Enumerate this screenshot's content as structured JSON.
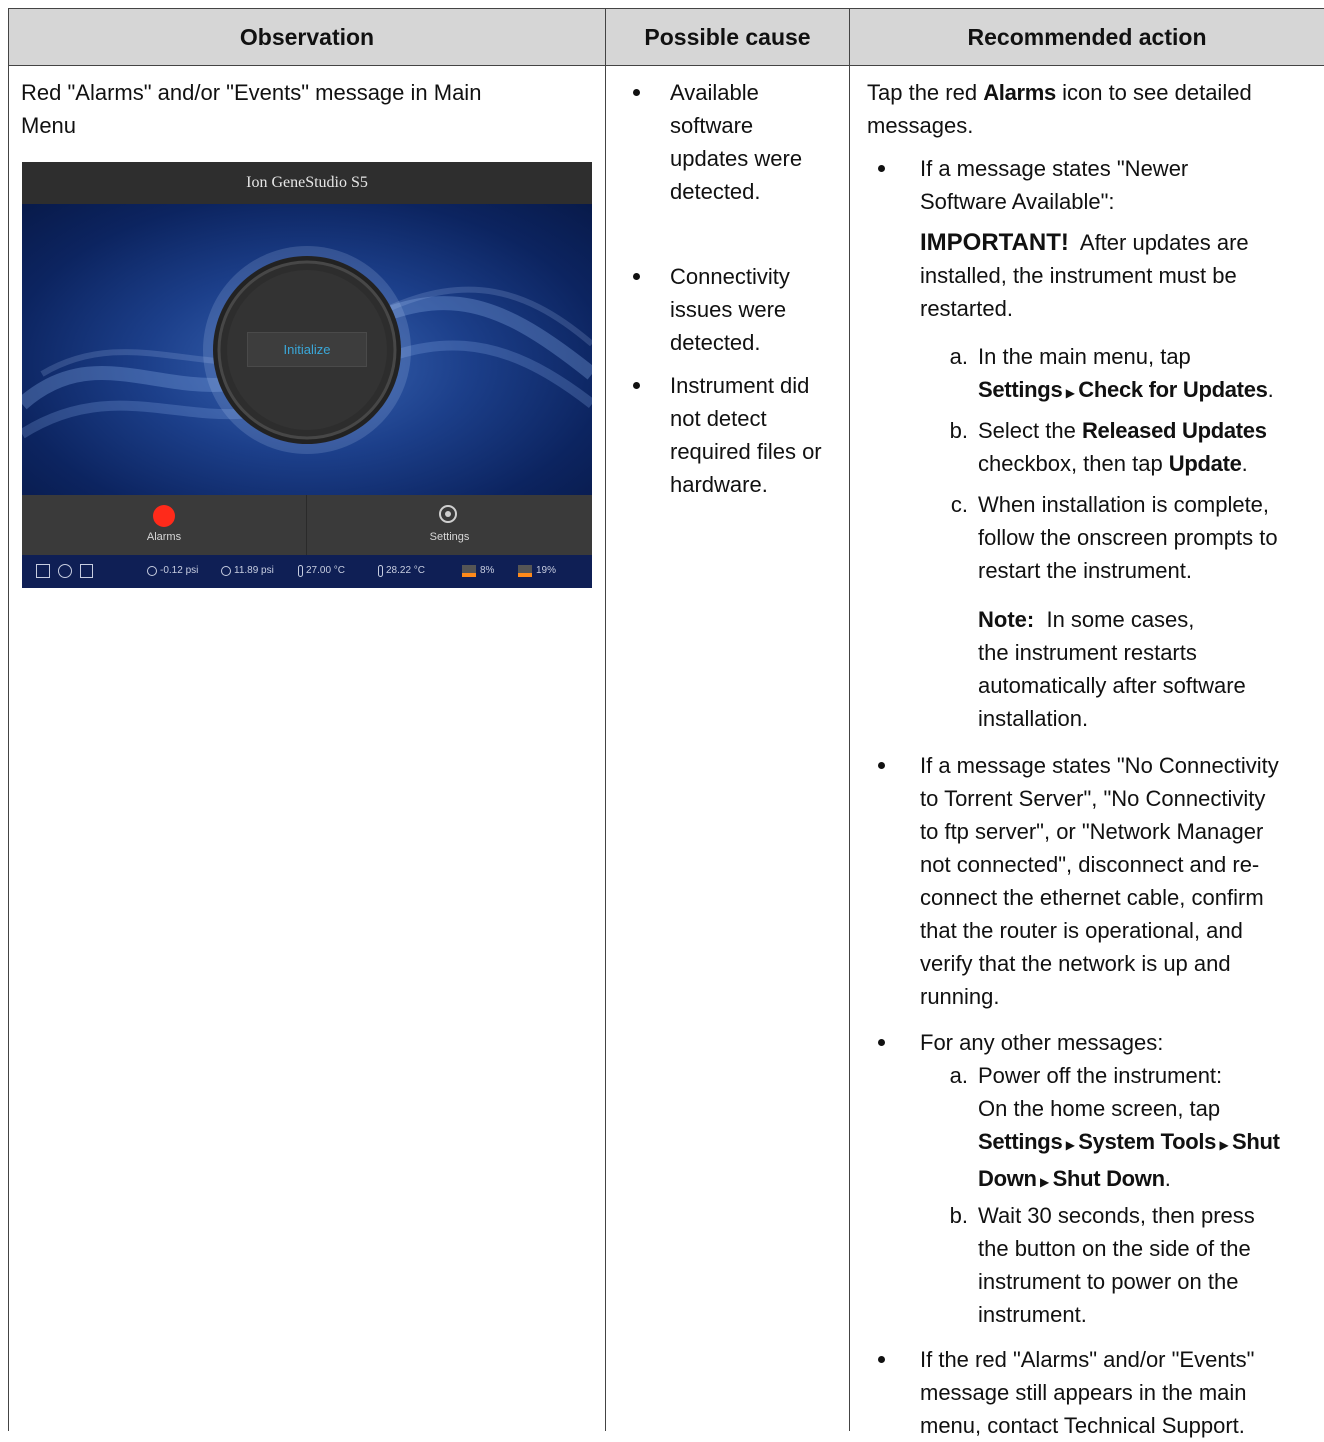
{
  "headers": {
    "observation": "Observation",
    "cause": "Possible cause",
    "action": "Recommended action"
  },
  "observation": {
    "line1": "Red \"Alarms\" and/or \"Events\" message in Main",
    "line2": "Menu"
  },
  "screen": {
    "title": "Ion GeneStudio S5",
    "initialize": "Initialize",
    "alarms": "Alarms",
    "settings": "Settings",
    "status": {
      "p1": "-0.12 psi",
      "p2": "11.89 psi",
      "t1": "27.00 °C",
      "t2": "28.22 °C",
      "l1": "8%",
      "l2": "19%"
    }
  },
  "causes": [
    [
      "Available",
      "software",
      "updates were",
      "detected."
    ],
    [
      "Connectivity",
      "issues were",
      "detected."
    ],
    [
      "Instrument did",
      "not detect",
      "required files or",
      "hardware."
    ]
  ],
  "action": {
    "intro_a": "Tap the red ",
    "intro_alarms": "Alarms",
    "intro_b": " icon to see detailed",
    "intro_c": "messages.",
    "b1_l1": "If a message states \"Newer",
    "b1_l2": "Software Available\":",
    "important_label": "IMPORTANT!",
    "important_l1": "After updates are",
    "important_l2": "installed, the instrument must be",
    "important_l3": "restarted.",
    "a_letter": "a.",
    "a_l1": "In the main menu, tap",
    "settings": "Settings",
    "check_updates": "Check for Updates",
    "b_letter": "b.",
    "b_select": "Select the ",
    "released_updates": "Released Updates",
    "b_l2a": "checkbox, then tap ",
    "update": "Update",
    "c_letter": "c.",
    "c_l1": "When installation is complete,",
    "c_l2": "follow the onscreen prompts to",
    "c_l3": "restart the instrument.",
    "note_label": "Note:",
    "note_l1": "In some cases,",
    "note_l2": "the instrument restarts",
    "note_l3": "automatically after software",
    "note_l4": "installation.",
    "b2_lines": [
      "If a message states \"No Connectivity",
      "to Torrent Server\", \"No Connectivity",
      "to ftp server\", or \"Network Manager",
      "not connected\", disconnect and re-",
      "connect the ethernet cable, confirm",
      "that the router is operational, and",
      "verify that the network is up and",
      "running."
    ],
    "b3_l1": "For any other messages:",
    "pa_letter": "a.",
    "pa_l1": "Power off the instrument:",
    "pa_l2": "On the home screen, tap",
    "system_tools": "System Tools",
    "shut": "Shut",
    "down": "Down",
    "shut_down": "Shut Down",
    "pb_letter": "b.",
    "pb_lines": [
      "Wait 30 seconds, then press",
      "the button on the side of the",
      "instrument to power on the",
      "instrument."
    ],
    "b4_lines": [
      "If the red \"Alarms\" and/or \"Events\"",
      "message still appears in the main",
      "menu, contact Technical Support."
    ],
    "period": "."
  }
}
